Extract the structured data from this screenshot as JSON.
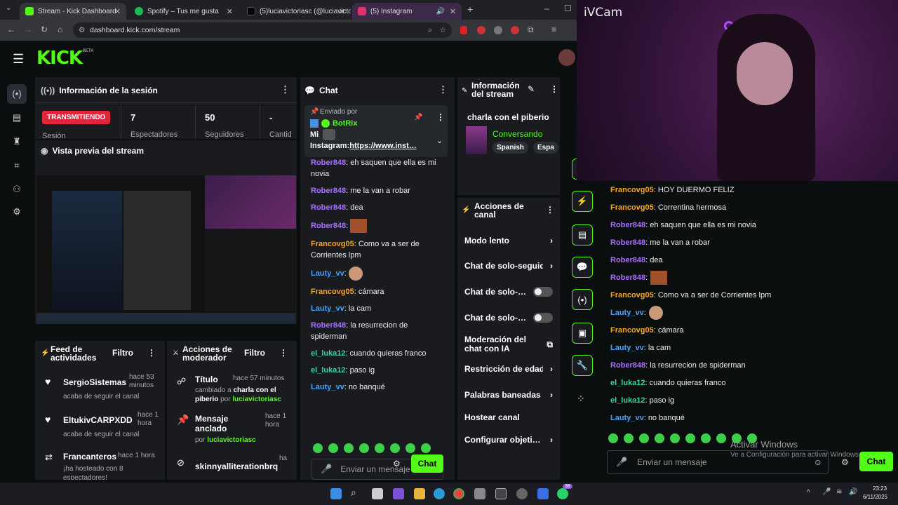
{
  "browser": {
    "tabs": [
      {
        "title": "Stream - Kick Dashboard",
        "color": "#53fc18"
      },
      {
        "title": "Spotify – Tus me gusta",
        "color": "#1db954"
      },
      {
        "title": "(5)luciavictoriasc (@luciavictori…",
        "color": "#111111"
      },
      {
        "title": "(5) Instagram",
        "color": "#e1306c"
      }
    ],
    "url": "dashboard.kick.com/stream"
  },
  "app": {
    "logo": "KICK",
    "logo_badge": "BETA",
    "session": {
      "title": "Información de la sesión",
      "status": "TRANSMITIENDO",
      "stats": [
        {
          "value": "7",
          "label": "Espectadores"
        },
        {
          "value": "50",
          "label": "Seguidores"
        },
        {
          "value": "-",
          "label": "Cantid"
        }
      ],
      "status_sub": "Sesión"
    },
    "preview": {
      "title": "Vista previa del stream"
    },
    "chat": {
      "title": "Chat",
      "pinned_label": "Enviado por",
      "pinned_user": "BotRix",
      "pinned_text_a": "Mi",
      "pinned_text_b": "Instagram:",
      "pinned_link": "https://www.inst…",
      "messages": [
        {
          "user": "Rober848",
          "text": ": eh saquen que ella es mi novia",
          "cls": "u-purple"
        },
        {
          "user": "Rober848",
          "text": ": me la van a robar",
          "cls": "u-purple"
        },
        {
          "user": "Rober848",
          "text": ": dea",
          "cls": "u-purple"
        },
        {
          "user": "Rober848",
          "text": ":",
          "cls": "u-purple"
        },
        {
          "user": "Francovg05",
          "text": ": Como va a ser de Corrientes lpm",
          "cls": "u-orange"
        },
        {
          "user": "Lauty_vv",
          "text": ":",
          "cls": "u-blue"
        },
        {
          "user": "Francovg05",
          "text": ": cámara",
          "cls": "u-orange"
        },
        {
          "user": "Lauty_vv",
          "text": ": la cam",
          "cls": "u-blue"
        },
        {
          "user": "Rober848",
          "text": ": la resurrecion de spiderman",
          "cls": "u-purple"
        },
        {
          "user": "el_luka12",
          "text": ": cuando quieras franco",
          "cls": "u-teal"
        },
        {
          "user": "el_luka12",
          "text": ": paso ig",
          "cls": "u-teal"
        },
        {
          "user": "Lauty_vv",
          "text": ": no banqué",
          "cls": "u-blue"
        }
      ],
      "input_placeholder": "Enviar un mensaje",
      "send": "Chat"
    },
    "stream_info": {
      "title": "Información del stream",
      "stream_title": "charla con el piberio",
      "category": "Conversando",
      "tags": [
        "Spanish",
        "Espa"
      ]
    },
    "channel_actions": {
      "title": "Acciones de canal",
      "items": [
        {
          "label": "Modo lento",
          "ctl": "chevron"
        },
        {
          "label": "Chat de solo-seguid",
          "ctl": "chevron"
        },
        {
          "label": "Chat de solo-…",
          "ctl": "toggle"
        },
        {
          "label": "Chat de solo-…",
          "ctl": "toggle"
        },
        {
          "label": "Moderación del chat con IA",
          "ctl": "ext"
        },
        {
          "label": "Restricción de edad",
          "ctl": "chevron"
        },
        {
          "label": "Palabras baneadas",
          "ctl": "chevron"
        },
        {
          "label": "Hostear canal",
          "ctl": "none"
        },
        {
          "label": "Configurar objeti…",
          "ctl": "chevron"
        }
      ]
    },
    "activity": {
      "title": "Feed de actividades",
      "filter": "Filtro",
      "items": [
        {
          "name": "SergioSistemas",
          "time": "hace 53 minutos",
          "desc": "acaba de seguir el canal"
        },
        {
          "name": "EltukivCARPXDD",
          "time": "hace 1 hora",
          "desc": "acaba de seguir el canal"
        },
        {
          "name": "Francanteros",
          "time": "hace 1 hora",
          "desc": "¡ha hosteado con 8 espectadores!"
        }
      ]
    },
    "modactions": {
      "title": "Acciones de moderador",
      "filter": "Filtro",
      "items": [
        {
          "name": "Título",
          "time": "hace 57 minutos",
          "desc_a": "cambiado a ",
          "desc_b": "charla con el piberio",
          "desc_c": " por ",
          "desc_d": "luciavictoriasc"
        },
        {
          "name": "Mensaje anclado",
          "time": "hace 1 hora",
          "desc_a": "por ",
          "desc_b": "luciavictoriasc"
        },
        {
          "name": "skinnyalliterationbrq",
          "time": "ha"
        }
      ]
    }
  },
  "overlay": {
    "ivcam": "iVCam",
    "chat_messages": [
      {
        "user": "Francovg05",
        "text": ": HOY DUERMO FELIZ",
        "cls": "u-orange"
      },
      {
        "user": "Francovg05",
        "text": ": Correntina hermosa",
        "cls": "u-orange"
      },
      {
        "user": "Rober848",
        "text": ": eh saquen que ella es mi novia",
        "cls": "u-purple"
      },
      {
        "user": "Rober848",
        "text": ": me la van a robar",
        "cls": "u-purple"
      },
      {
        "user": "Rober848",
        "text": ": dea",
        "cls": "u-purple"
      },
      {
        "user": "Rober848",
        "text": ":",
        "cls": "u-purple"
      },
      {
        "user": "Francovg05",
        "text": ": Como va a ser de Corrientes lpm",
        "cls": "u-orange"
      },
      {
        "user": "Lauty_vv",
        "text": ":",
        "cls": "u-blue"
      },
      {
        "user": "Francovg05",
        "text": ": cámara",
        "cls": "u-orange"
      },
      {
        "user": "Lauty_vv",
        "text": ": la cam",
        "cls": "u-blue"
      },
      {
        "user": "Rober848",
        "text": ": la resurrecion de spiderman",
        "cls": "u-purple"
      },
      {
        "user": "el_luka12",
        "text": ": cuando quieras franco",
        "cls": "u-teal"
      },
      {
        "user": "el_luka12",
        "text": ": paso ig",
        "cls": "u-teal"
      },
      {
        "user": "Lauty_vv",
        "text": ": no banqué",
        "cls": "u-blue"
      }
    ],
    "input_placeholder": "Enviar un mensaje",
    "send": "Chat",
    "watermark_title": "Activar Windows",
    "watermark_sub": "Ve a Configuración para activar Windows."
  },
  "taskbar": {
    "time": "23:23",
    "date": "6/11/2025",
    "badge": "38"
  }
}
